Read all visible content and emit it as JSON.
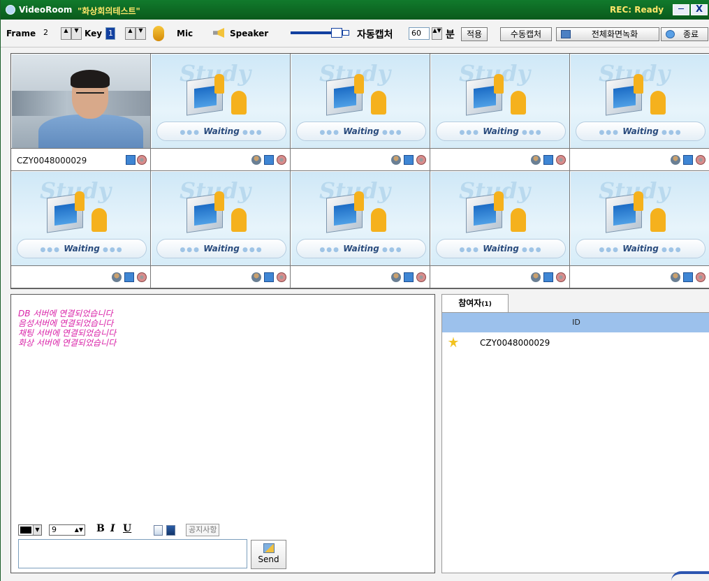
{
  "window": {
    "app_name": "VideoRoom",
    "room_name": "\"화상회의테스트\"",
    "rec_status": "REC: Ready",
    "min_label": "─",
    "close_label": "X"
  },
  "toolbar": {
    "frame_label": "Frame",
    "frame_value": "2",
    "key_label": "Key",
    "key_value": "1",
    "mic_label": "Mic",
    "speaker_label": "Speaker",
    "auto_capture_label": "자동캡처",
    "auto_capture_value": "60",
    "minute_label": "분",
    "apply_label": "적용",
    "manual_capture_label": "수동캡처",
    "fullscreen_record_label": "전체화면녹화",
    "exit_label": "종료"
  },
  "video_slots": [
    {
      "id": "CZY0048000029",
      "status": "live"
    },
    {
      "id": "",
      "status": "Waiting"
    },
    {
      "id": "",
      "status": "Waiting"
    },
    {
      "id": "",
      "status": "Waiting"
    },
    {
      "id": "",
      "status": "Waiting"
    },
    {
      "id": "",
      "status": "Waiting"
    },
    {
      "id": "",
      "status": "Waiting"
    },
    {
      "id": "",
      "status": "Waiting"
    },
    {
      "id": "",
      "status": "Waiting"
    },
    {
      "id": "",
      "status": "Waiting"
    }
  ],
  "waiting_text": "Waiting",
  "watermark": "Study",
  "chat": {
    "log": [
      "DB 서버에 연결되었습니다",
      "음성서버에 연결되었습니다",
      "채팅 서버에 연결되었습니다",
      "화상 서버에 연결되었습니다"
    ],
    "log_color": "#d923a8",
    "font_color": "#000000",
    "font_size": "9",
    "bold_label": "B",
    "italic_label": "I",
    "underline_label": "U",
    "notice_label": "공지사항",
    "input_value": "",
    "send_label": "Send"
  },
  "participants": {
    "tab_label": "참여자",
    "tab_count": "(1)",
    "column_header": "ID",
    "rows": [
      {
        "id": "CZY0048000029",
        "icon": "star-icon"
      }
    ]
  }
}
